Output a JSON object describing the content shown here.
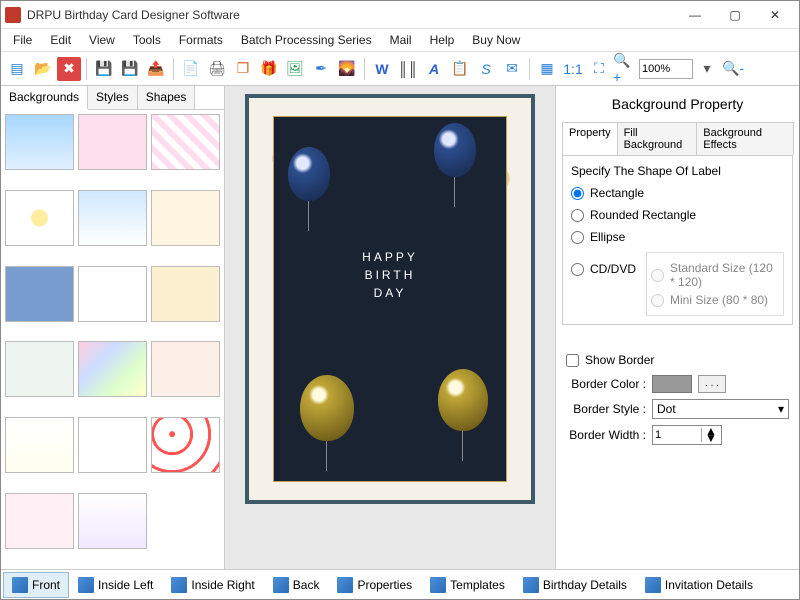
{
  "window": {
    "title": "DRPU Birthday Card Designer Software"
  },
  "menu": [
    "File",
    "Edit",
    "View",
    "Tools",
    "Formats",
    "Batch Processing Series",
    "Mail",
    "Help",
    "Buy Now"
  ],
  "toolbar": {
    "zoom": "100%"
  },
  "leftTabs": [
    "Backgrounds",
    "Styles",
    "Shapes"
  ],
  "card": {
    "line1": "HAPPY",
    "line2": "BIRTH",
    "line3": "DAY"
  },
  "propPanel": {
    "title": "Background Property",
    "tabs": [
      "Property",
      "Fill Background",
      "Background Effects"
    ],
    "shapeLabel": "Specify The Shape Of Label",
    "shapes": [
      "Rectangle",
      "Rounded Rectangle",
      "Ellipse",
      "CD/DVD"
    ],
    "cdOptions": [
      "Standard Size (120 * 120)",
      "Mini Size (80 * 80)"
    ],
    "showBorder": "Show Border",
    "borderColorLabel": "Border Color :",
    "borderStyleLabel": "Border Style :",
    "borderStyleValue": "Dot",
    "borderWidthLabel": "Border Width :",
    "borderWidthValue": "1",
    "dots": ". . ."
  },
  "bottomTabs": [
    "Front",
    "Inside Left",
    "Inside Right",
    "Back",
    "Properties",
    "Templates",
    "Birthday Details",
    "Invitation Details"
  ]
}
